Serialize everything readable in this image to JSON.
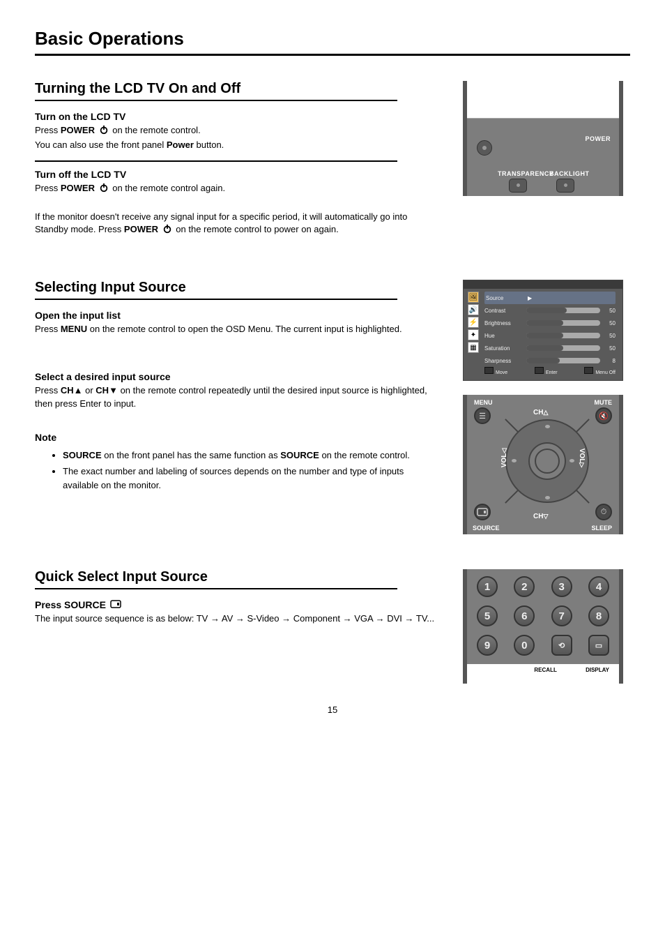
{
  "page_title": "Basic Operations",
  "hr": "",
  "sec1": {
    "heading": "Turning the LCD TV On and Off",
    "step1_head": "Turn on the LCD TV",
    "step1_body_a": "Press ",
    "step1_body_b": "POWER",
    "step1_body_c": " on the remote control.",
    "step1_body_d": "You can also use the front panel ",
    "step1_body_e": "Power",
    "step1_body_f": " button.",
    "step2_head": "Turn off the LCD TV",
    "step2_body_a": "Press ",
    "step2_body_b": "POWER",
    "step2_body_c": " on the remote control again.",
    "note_a": "If the monitor doesn't receive any signal input for a specific period, it will automatically go into Standby mode. Press ",
    "note_b": "POWER",
    "note_c": " on the remote control to power on again."
  },
  "remote_top": {
    "power_label": "POWER",
    "transparency_label": "TRANSPARENCY",
    "backlight_label": "BACKLIGHT"
  },
  "sec2": {
    "heading": "Selecting Input Source",
    "step1_head": "Open the input list",
    "step1_a": "Press ",
    "step1_b": "MENU",
    "step1_c": " on the remote control to open the OSD Menu. The current input is highlighted.",
    "step2_head": "Select a desired input source",
    "step2_a": "Press ",
    "step2_b": "CH",
    "step2_tri_up": "▲",
    "step2_c": " or ",
    "step2_d": " CH",
    "step2_tri_dn": "▼",
    "step2_e": " on the remote control repeatedly until the desired input source is highlighted, then press Enter to input.",
    "note_head": "Note",
    "note1_a": "SOURCE",
    "note1_b": " on the front panel has the same function as ",
    "note1_c": "SOURCE",
    "note1_d": " on the remote control.",
    "note2_a": "The exact number and labeling of sources depends on the number and type of inputs available on the monitor."
  },
  "osd": {
    "tabs": [
      "🖼",
      "🔊",
      "⚡",
      "✦",
      "▦"
    ],
    "rows": [
      {
        "label": "Source",
        "value": "",
        "tri": "▶",
        "fill": 0
      },
      {
        "label": "Contrast",
        "value": "50",
        "fill": 55
      },
      {
        "label": "Brightness",
        "value": "50",
        "fill": 50
      },
      {
        "label": "Hue",
        "value": "50",
        "fill": 50
      },
      {
        "label": "Saturation",
        "value": "50",
        "fill": 50
      },
      {
        "label": "Sharpness",
        "value": "8",
        "fill": 45
      }
    ],
    "bottom": [
      {
        "icon": "▦",
        "text": "Move"
      },
      {
        "icon": "◧",
        "text": "Enter"
      },
      {
        "icon": "▭",
        "text": "Menu Off"
      }
    ]
  },
  "dpad": {
    "menu": "MENU",
    "mute": "MUTE",
    "source": "SOURCE",
    "sleep": "SLEEP",
    "ch_up": "CH",
    "ch_dn": "CH",
    "vol_l": "VOL",
    "vol_r": "VOL"
  },
  "sec3": {
    "heading": "Quick Select Input Source",
    "step1_head": "Press SOURCE",
    "step1_a": "The input source sequence is as below: TV ",
    "step1_arrow": "→",
    "step1_b": " AV ",
    "step1_c": " S-Video ",
    "step1_d": " Component ",
    "step1_e": " VGA ",
    "step1_f": " DVI ",
    "step1_g": " TV..."
  },
  "keypad": {
    "keys": [
      "1",
      "2",
      "3",
      "4",
      "5",
      "6",
      "7",
      "8",
      "9",
      "0",
      "⟲",
      "▭"
    ],
    "labels_bottom": [
      "",
      "",
      "RECALL",
      "DISPLAY"
    ]
  },
  "page_number": "15"
}
